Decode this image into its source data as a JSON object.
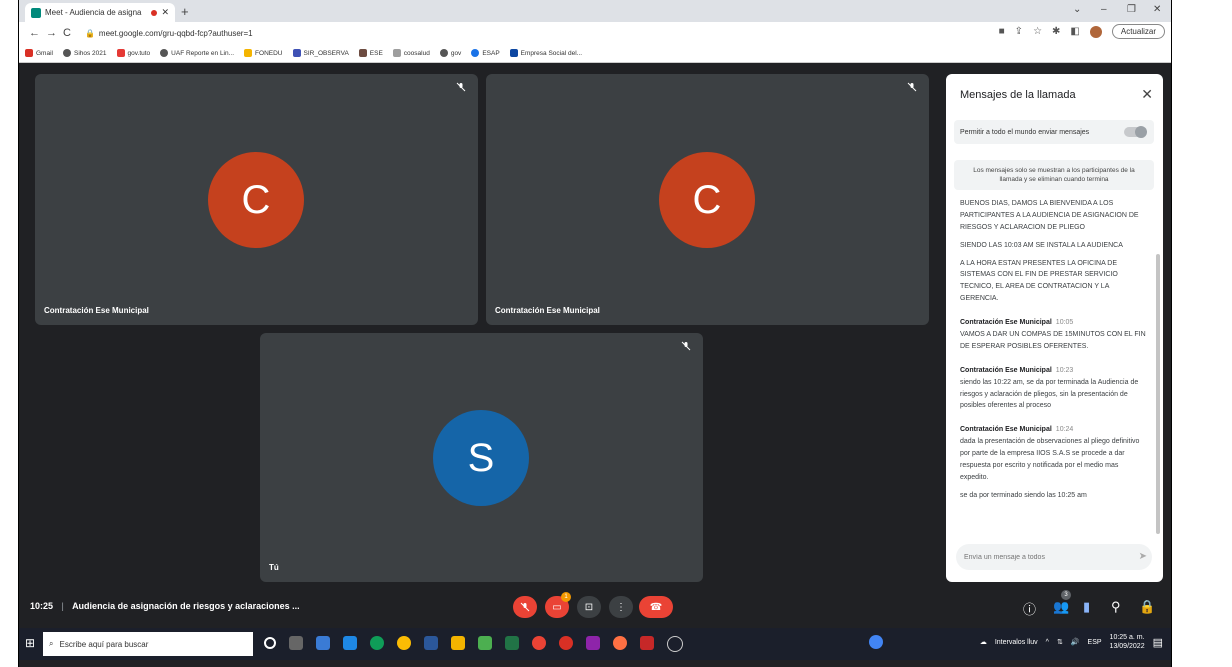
{
  "browser": {
    "tab_title": "Meet - Audiencia de asigna",
    "url": "meet.google.com/gru-qqbd-fcp?authuser=1",
    "update_label": "Actualizar",
    "bookmarks": [
      "Gmail",
      "Sihos 2021",
      "gov.tuto",
      "UAF Reporte en Lin...",
      "FONEDU",
      "SIR_OBSERVA",
      "ESE",
      "coosalud",
      "gov",
      "ESAP",
      "Empresa Social del..."
    ]
  },
  "tiles": [
    {
      "name": "Contratación Ese Municipal",
      "initial": "C",
      "color": "#c5411e"
    },
    {
      "name": "Contratación Ese Municipal",
      "initial": "C",
      "color": "#c5411e"
    },
    {
      "name": "Tú",
      "initial": "S",
      "color": "#1565a8"
    }
  ],
  "chat": {
    "title": "Mensajes de la llamada",
    "allow_label": "Permitir a todo el mundo enviar mensajes",
    "notice": "Los mensajes solo se muestran a los participantes de la llamada y se eliminan cuando termina",
    "messages": [
      {
        "sender": "",
        "time": "",
        "text": "BUENOS DIAS, DAMOS LA BIENVENIDA A LOS PARTICIPANTES A LA AUDIENCIA DE ASIGNACION DE RIESGOS Y ACLARACION DE PLIEGO"
      },
      {
        "sender": "",
        "time": "",
        "text": "SIENDO LAS 10:03 AM SE INSTALA LA AUDIENCA"
      },
      {
        "sender": "",
        "time": "",
        "text": "A LA HORA ESTAN PRESENTES LA OFICINA DE SISTEMAS CON EL FIN DE PRESTAR SERVICIO TECNICO, EL AREA DE CONTRATACION Y LA GERENCIA."
      },
      {
        "sender": "Contratación Ese Municipal",
        "time": "10:05",
        "text": "VAMOS A DAR UN COMPAS DE 15MINUTOS CON EL FIN DE ESPERAR POSIBLES OFERENTES."
      },
      {
        "sender": "Contratación Ese Municipal",
        "time": "10:23",
        "text": "siendo las 10:22 am, se da por terminada la Audiencia de riesgos y aclaración de pliegos, sin la presentación de posibles oferentes al proceso"
      },
      {
        "sender": "Contratación Ese Municipal",
        "time": "10:24",
        "text": "dada la presentación de observaciones al pliego definitivo por parte de la empresa IIOS S.A.S se procede a dar respuesta por escrito y notificada por el medio mas expedito."
      },
      {
        "sender": "",
        "time": "",
        "text": "se da por terminado siendo las 10:25 am"
      }
    ],
    "input_placeholder": "Envía un mensaje a todos"
  },
  "meeting": {
    "time": "10:25",
    "title": "Audiencia de asignación de riesgos y aclaraciones ...",
    "people_count": "3",
    "chat_badge": "1"
  },
  "taskbar": {
    "search_placeholder": "Escribe aquí para buscar",
    "weather": "Intervalos lluv",
    "lang": "ESP",
    "clock_time": "10:25 a. m.",
    "clock_date": "13/09/2022"
  },
  "colors": {
    "meet_bg": "#202124",
    "tile_bg": "#3c4043",
    "hangup": "#ea4335",
    "muted_button": "#ea4335",
    "chat_icon": "#8ab4f8"
  }
}
